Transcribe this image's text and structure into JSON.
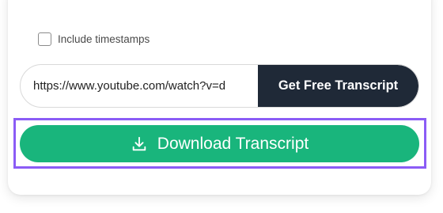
{
  "options": {
    "include_timestamps_label": "Include timestamps",
    "include_timestamps_checked": false
  },
  "url_input": {
    "value": "https://www.youtube.com/watch?v=d"
  },
  "buttons": {
    "get_transcript_label": "Get Free Transcript",
    "download_label": "Download Transcript"
  },
  "icons": {
    "download": "download-icon"
  },
  "colors": {
    "primary_dark": "#1f2937",
    "download_green": "#19b57c",
    "highlight_purple": "#8b5cf6"
  }
}
